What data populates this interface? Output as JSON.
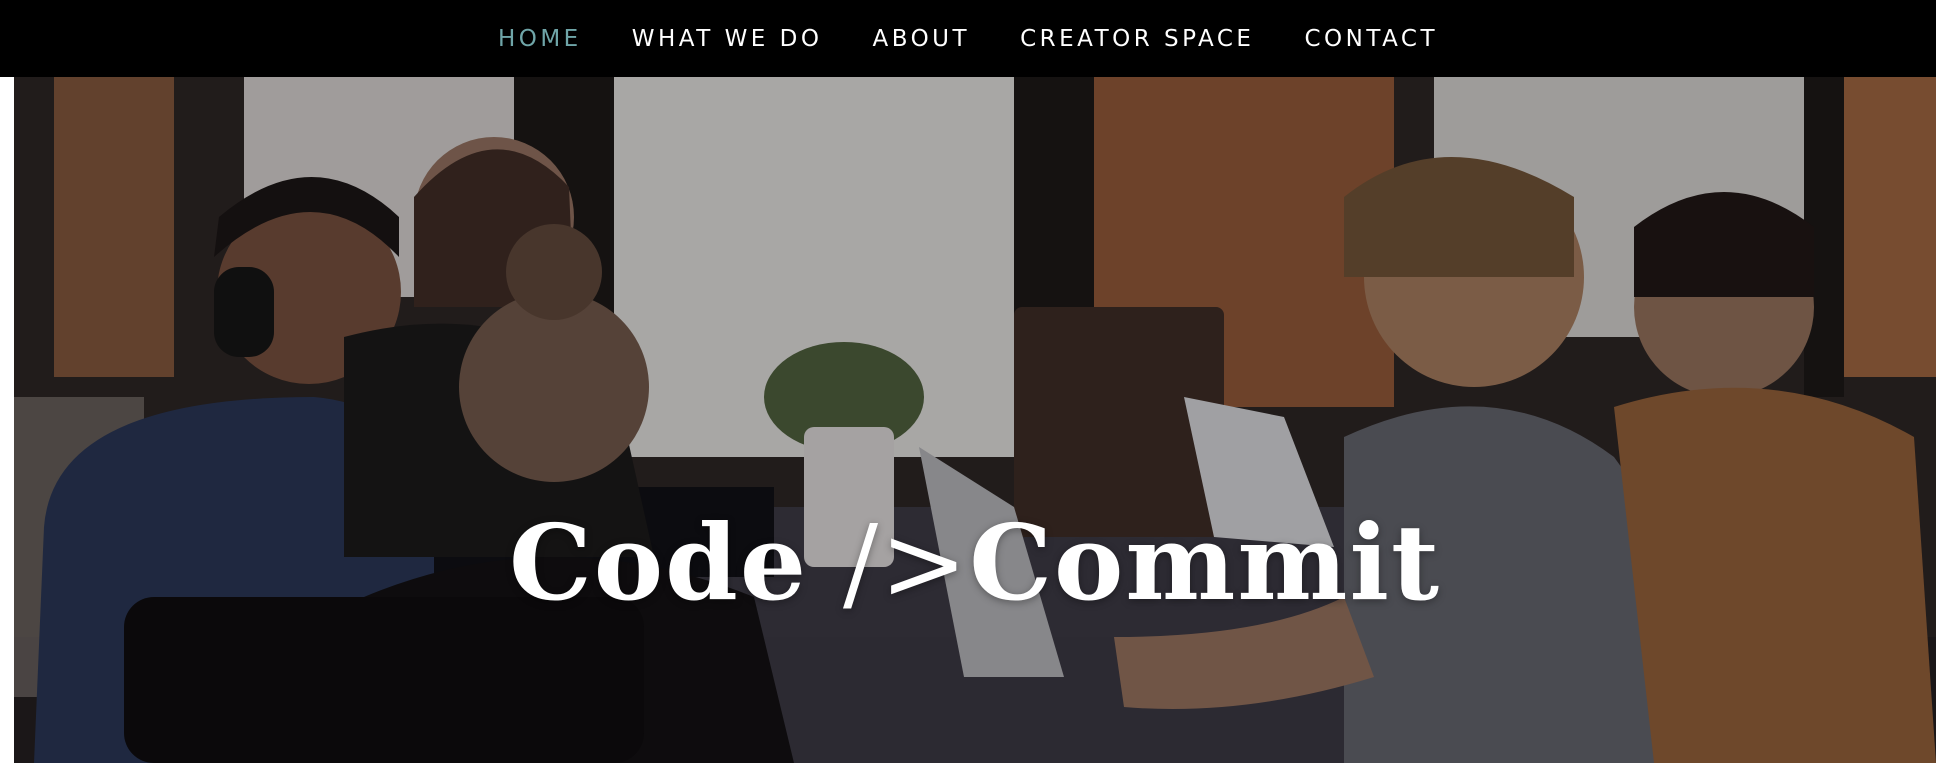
{
  "nav": {
    "items": [
      {
        "label": "HOME",
        "active": true
      },
      {
        "label": "WHAT WE DO",
        "active": false
      },
      {
        "label": "ABOUT",
        "active": false
      },
      {
        "label": "CREATOR SPACE",
        "active": false
      },
      {
        "label": "CONTACT",
        "active": false
      }
    ]
  },
  "hero": {
    "title_part1": "Code",
    "title_part2": " />",
    "title_part3": "Commit"
  },
  "colors": {
    "nav_bg": "#000000",
    "nav_text": "#ffffff",
    "nav_active": "#6fa5a8",
    "hero_title": "#ffffff"
  }
}
